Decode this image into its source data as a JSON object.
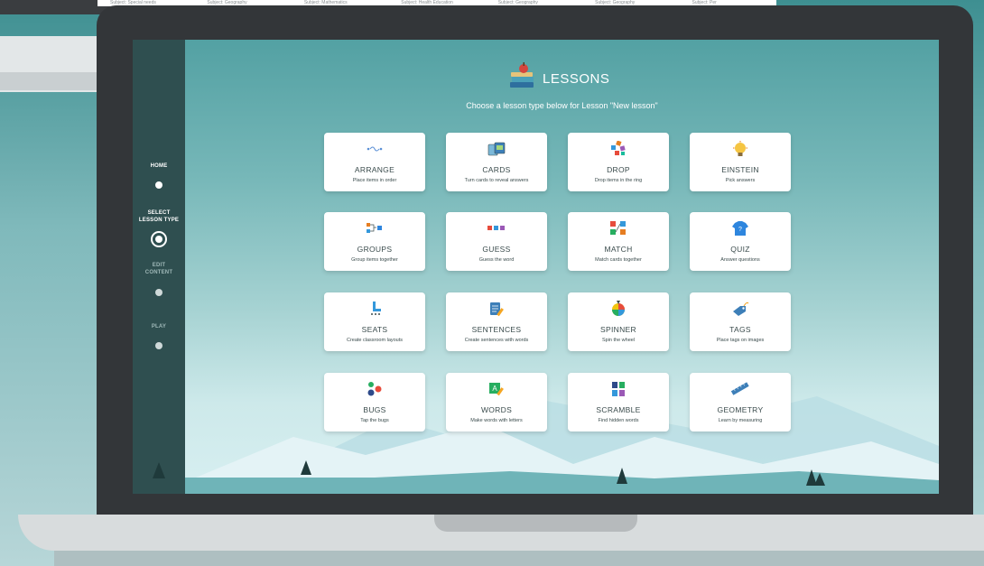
{
  "background_monitor": {
    "subjects": [
      "Subject: Special needs",
      "Subject: Geography",
      "Subject: Mathematics",
      "Subject: Health Education",
      "Subject: Geography",
      "Subject: Geography",
      "Subject: Per"
    ]
  },
  "sidebar": {
    "steps": [
      {
        "label": "HOME",
        "state": "done"
      },
      {
        "label": "SELECT\nLESSON TYPE",
        "state": "current"
      },
      {
        "label": "EDIT\nCONTENT",
        "state": "pending"
      },
      {
        "label": "PLAY",
        "state": "pending"
      }
    ]
  },
  "header": {
    "title": "LESSONS",
    "subtitle": "Choose a lesson type below for Lesson \"New lesson\""
  },
  "lesson_types": [
    {
      "name": "ARRANGE",
      "desc": "Place items in order",
      "icon": "arrange-icon"
    },
    {
      "name": "CARDS",
      "desc": "Turn cards to reveal answers",
      "icon": "cards-icon"
    },
    {
      "name": "DROP",
      "desc": "Drop items in the ring",
      "icon": "drop-icon"
    },
    {
      "name": "EINSTEIN",
      "desc": "Pick answers",
      "icon": "lightbulb-icon"
    },
    {
      "name": "GROUPS",
      "desc": "Group items together",
      "icon": "groups-icon"
    },
    {
      "name": "GUESS",
      "desc": "Guess the word",
      "icon": "guess-icon"
    },
    {
      "name": "MATCH",
      "desc": "Match cards together",
      "icon": "match-icon"
    },
    {
      "name": "QUIZ",
      "desc": "Answer questions",
      "icon": "quiz-shirt-icon"
    },
    {
      "name": "SEATS",
      "desc": "Create classroom layouts",
      "icon": "chair-icon"
    },
    {
      "name": "SENTENCES",
      "desc": "Create sentences with words",
      "icon": "sentences-icon"
    },
    {
      "name": "SPINNER",
      "desc": "Spin the wheel",
      "icon": "spinner-wheel-icon"
    },
    {
      "name": "TAGS",
      "desc": "Place tags on images",
      "icon": "tag-icon"
    },
    {
      "name": "BUGS",
      "desc": "Tap the bugs",
      "icon": "bugs-icon"
    },
    {
      "name": "WORDS",
      "desc": "Make words with letters",
      "icon": "words-icon"
    },
    {
      "name": "SCRAMBLE",
      "desc": "Find hidden words",
      "icon": "scramble-icon"
    },
    {
      "name": "GEOMETRY",
      "desc": "Learn by measuring",
      "icon": "ruler-icon"
    }
  ],
  "colors": {
    "sidebar": "#2f4f50",
    "app_top": "#53a1a3",
    "card": "#ffffff",
    "card_text": "#3a4b4c"
  }
}
